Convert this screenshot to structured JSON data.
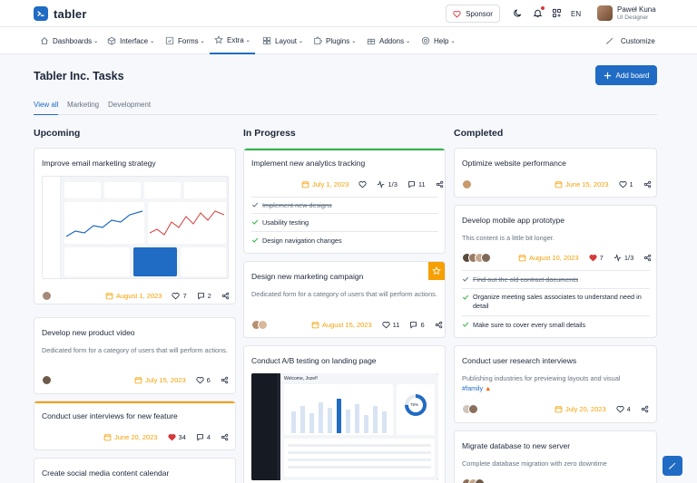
{
  "brand": {
    "name": "tabler"
  },
  "header": {
    "sponsor_label": "Sponsor",
    "lang": "EN",
    "user_name": "Paweł Kuna",
    "user_role": "UI Designer"
  },
  "nav": [
    {
      "label": "Dashboards"
    },
    {
      "label": "Interface"
    },
    {
      "label": "Forms"
    },
    {
      "label": "Extra"
    },
    {
      "label": "Layout"
    },
    {
      "label": "Plugins"
    },
    {
      "label": "Addons"
    },
    {
      "label": "Help"
    },
    {
      "label": "Customize"
    }
  ],
  "page": {
    "title": "Tabler Inc. Tasks",
    "add_board_label": "Add board"
  },
  "tabs": [
    "View all",
    "Marketing",
    "Development"
  ],
  "columns": [
    "Upcoming",
    "In Progress",
    "Completed"
  ],
  "colors": {
    "primary": "#206bc4",
    "accent": "#f59f00",
    "success": "#2fb344",
    "danger": "#d63939"
  },
  "upcoming": {
    "c1": {
      "title": "Improve email marketing strategy",
      "date": "August 1, 2023",
      "likes": "7",
      "comments": "2"
    },
    "c2": {
      "title": "Develop new product video",
      "desc": "Dedicated form for a category of users that will perform actions.",
      "date": "July 15, 2023",
      "likes": "6"
    },
    "c3": {
      "title": "Conduct user interviews for new feature",
      "date": "June 20, 2023",
      "likes": "34",
      "comments": "4"
    },
    "c4": {
      "title": "Create social media content calendar"
    }
  },
  "progress": {
    "c1": {
      "title": "Implement new analytics tracking",
      "date": "July 1, 2023",
      "tasks": "1/3",
      "comments": "11",
      "checklist": [
        "Implement new designs",
        "Usability testing",
        "Design navigation changes"
      ]
    },
    "c2": {
      "title": "Design new marketing campaign",
      "desc": "Dedicated form for a category of users that will perform actions.",
      "date": "August 15, 2023",
      "likes": "11",
      "comments": "6"
    },
    "c3": {
      "title": "Conduct A/B testing on landing page"
    },
    "mock": {
      "header": "Welcome, Jozef!",
      "stat": "75%"
    }
  },
  "completed": {
    "c1": {
      "title": "Optimize website performance",
      "date": "June 15, 2023",
      "likes": "1"
    },
    "c2": {
      "title": "Develop mobile app prototype",
      "desc": "This content is a little bit longer.",
      "date": "August 10, 2023",
      "likes": "7",
      "tasks": "1/3",
      "checklist": [
        "Find out the old contract documents",
        "Organize meeting sales associates to understand need in detail",
        "Make sure to cover every small details"
      ]
    },
    "c3": {
      "title": "Conduct user research interviews",
      "desc": "Publishing industries for previewing layouts and visual",
      "tag": "#family",
      "date": "July 20, 2023",
      "likes": "4"
    },
    "c4": {
      "title": "Migrate database to new server",
      "desc": "Complete database migration with zero downtime"
    }
  }
}
